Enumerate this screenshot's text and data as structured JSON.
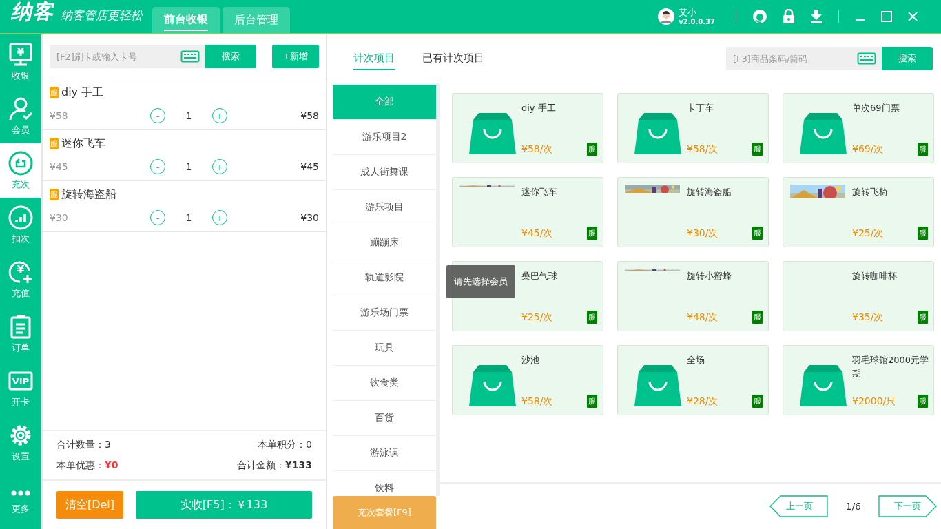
{
  "header": {
    "logo": "纳客",
    "slogan": "纳客管店更轻松",
    "tabs": [
      {
        "label": "前台收银",
        "selected": true
      },
      {
        "label": "后台管理",
        "selected": false
      }
    ],
    "user": {
      "name": "艾小",
      "version": "v2.0.0.37"
    }
  },
  "sidebar": {
    "items": [
      {
        "label": "收银",
        "icon_text": "¥",
        "selected": false
      },
      {
        "label": "会员",
        "selected": false
      },
      {
        "label": "充次",
        "selected": true
      },
      {
        "label": "扣次",
        "selected": false
      },
      {
        "label": "充值",
        "icon_text": "¥",
        "selected": false
      },
      {
        "label": "订单",
        "selected": false
      },
      {
        "label": "开卡",
        "icon_text": "VIP",
        "selected": false
      },
      {
        "label": "设置",
        "selected": false
      },
      {
        "label": "更多",
        "selected": false
      }
    ]
  },
  "cart": {
    "search": {
      "placeholder": "[F2]刷卡或输入卡号",
      "button": "搜索"
    },
    "add_button": "+新增",
    "items": [
      {
        "tag": "服",
        "name": "diy 手工",
        "unit_price": "¥58",
        "minus": "-",
        "qty": "1",
        "plus": "+",
        "total": "¥58"
      },
      {
        "tag": "服",
        "name": "迷你飞车",
        "unit_price": "¥45",
        "minus": "-",
        "qty": "1",
        "plus": "+",
        "total": "¥45"
      },
      {
        "tag": "服",
        "name": "旋转海盗船",
        "unit_price": "¥30",
        "minus": "-",
        "qty": "1",
        "plus": "+",
        "total": "¥30"
      }
    ],
    "summary": {
      "count_label": "合计数量：",
      "count": "3",
      "points_label": "本单积分：",
      "points": "0",
      "discount_label": "本单优惠：",
      "discount": "¥0",
      "total_label": "合计金额：",
      "total": "¥133"
    },
    "clear_button": "清空[Del]",
    "pay_button": "实收[F5]：￥133"
  },
  "tabs": [
    {
      "label": "计次项目",
      "selected": true
    },
    {
      "label": "已有计次项目",
      "selected": false
    }
  ],
  "search": {
    "placeholder": "[F3]商品条码/简码",
    "button": "搜索"
  },
  "categories": [
    {
      "label": "全部",
      "selected": true
    },
    {
      "label": "游乐项目2",
      "selected": false
    },
    {
      "label": "成人街舞课",
      "selected": false
    },
    {
      "label": "游乐项目",
      "selected": false
    },
    {
      "label": "蹦蹦床",
      "selected": false
    },
    {
      "label": "轨道影院",
      "selected": false
    },
    {
      "label": "游乐场门票",
      "selected": false
    },
    {
      "label": "玩具",
      "selected": false
    },
    {
      "label": "饮食类",
      "selected": false
    },
    {
      "label": "百货",
      "selected": false
    },
    {
      "label": "游泳课",
      "selected": false
    },
    {
      "label": "饮料",
      "selected": false
    }
  ],
  "package_button": "充次套餐[F9]",
  "products": [
    {
      "name": "diy 手工",
      "price": "¥58/次",
      "tag": "服",
      "kind": "bag"
    },
    {
      "name": "卡丁车",
      "price": "¥58/次",
      "tag": "服",
      "kind": "bag"
    },
    {
      "name": "单次69门票",
      "price": "¥69/次",
      "tag": "服",
      "kind": "bag"
    },
    {
      "name": "迷你飞车",
      "price": "¥45/次",
      "tag": "服",
      "kind": "picture"
    },
    {
      "name": "旋转海盗船",
      "price": "¥30/次",
      "tag": "服",
      "kind": "picture"
    },
    {
      "name": "旋转飞椅",
      "price": "¥25/次",
      "tag": "服",
      "kind": "picture"
    },
    {
      "name": "桑巴气球",
      "price": "¥25/次",
      "tag": "服",
      "kind": "plain"
    },
    {
      "name": "旋转小蜜蜂",
      "price": "¥48/次",
      "tag": "服",
      "kind": "picture"
    },
    {
      "name": "旋转咖啡杯",
      "price": "¥35/次",
      "tag": "服",
      "kind": "plain"
    },
    {
      "name": "沙池",
      "price": "¥58/次",
      "tag": "服",
      "kind": "bag"
    },
    {
      "name": "全场",
      "price": "¥28/次",
      "tag": "服",
      "kind": "bag"
    },
    {
      "name": "羽毛球馆2000元学期",
      "price": "¥2000/只",
      "tag": "服",
      "kind": "bag"
    }
  ],
  "tooltip": "请先选择会员",
  "pager": {
    "prev": "上一页",
    "page": "1/6",
    "next": "下一页"
  }
}
